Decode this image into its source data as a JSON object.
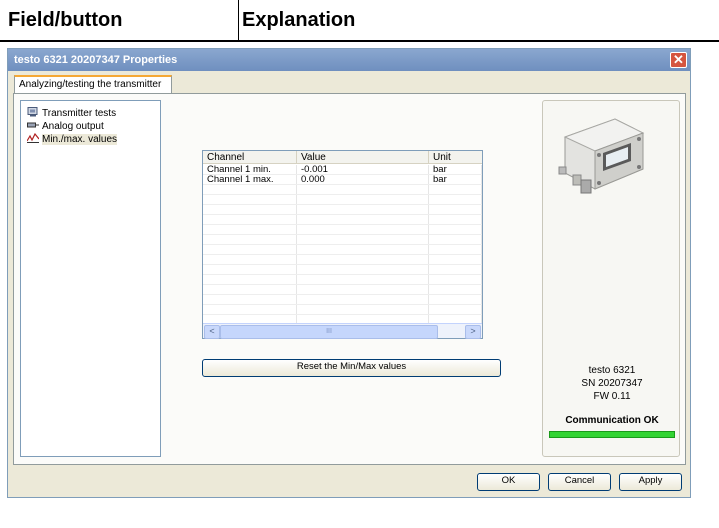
{
  "doc_header": {
    "col1": "Field/button",
    "col2": "Explanation"
  },
  "window": {
    "title": "testo 6321 20207347 Properties",
    "close_glyph": "✕"
  },
  "tab": {
    "label": "Analyzing/testing the transmitter"
  },
  "tree": {
    "items": [
      {
        "label": "Transmitter tests",
        "icon": "transmitter-test-icon"
      },
      {
        "label": "Analog output",
        "icon": "analog-output-icon"
      },
      {
        "label": "Min./max. values",
        "icon": "min-max-chart-icon",
        "selected": true
      }
    ]
  },
  "grid": {
    "columns": [
      "Channel",
      "Value",
      "Unit"
    ],
    "rows": [
      [
        "Channel 1 min.",
        "-0.001",
        "bar"
      ],
      [
        "Channel 1 max.",
        "0.000",
        "bar"
      ]
    ],
    "scroll_left": "<",
    "scroll_right": ">",
    "scroll_grip": "III"
  },
  "reset_button": "Reset the Min/Max values",
  "device": {
    "model": "testo 6321",
    "serial": "SN 20207347",
    "firmware": "FW  0.11",
    "status": "Communication OK",
    "status_color": "#33d433"
  },
  "buttons": {
    "ok": "OK",
    "cancel": "Cancel",
    "apply": "Apply"
  }
}
